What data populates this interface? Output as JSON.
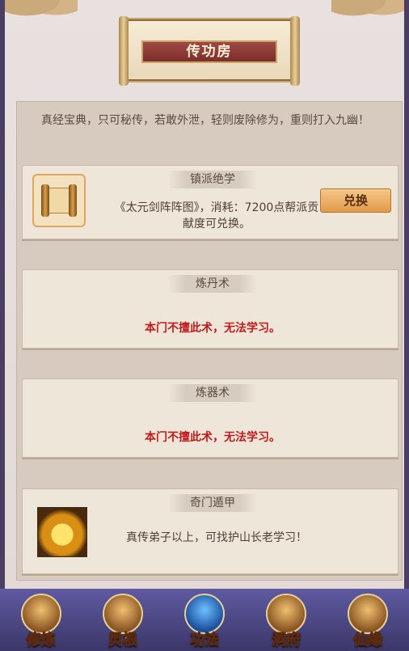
{
  "header": {
    "title": "传功房"
  },
  "intro": "真经宝典，只可秘传，若敢外泄，轻则废除修为，重则打入九幽！",
  "cards": [
    {
      "header": "镇派绝学",
      "text": "《太元剑阵阵图》，消耗：7200点帮派贡献度可兑换。",
      "button": "兑换",
      "icon": "scroll-icon"
    },
    {
      "header": "炼丹术",
      "text": "本门不擅此术，无法学习。"
    },
    {
      "header": "炼器术",
      "text": "本门不擅此术，无法学习。"
    },
    {
      "header": "奇门遁甲",
      "text": "真传弟子以上，可找护山长老学习！",
      "icon": "gold-treasure-icon"
    }
  ],
  "nav": [
    {
      "label": "修炼",
      "icon": "monk-icon"
    },
    {
      "label": "灵根",
      "icon": "yin-yang-icon"
    },
    {
      "label": "功法",
      "icon": "book-icon",
      "active": true
    },
    {
      "label": "洞府",
      "icon": "pavilion-icon"
    },
    {
      "label": "仙缘",
      "icon": "gourd-icon"
    }
  ],
  "colors": {
    "accent_red": "#c11b1b",
    "banner_red": "#8a3a35",
    "nav_bg": "#4b4680",
    "button_orange": "#e9a45a"
  }
}
